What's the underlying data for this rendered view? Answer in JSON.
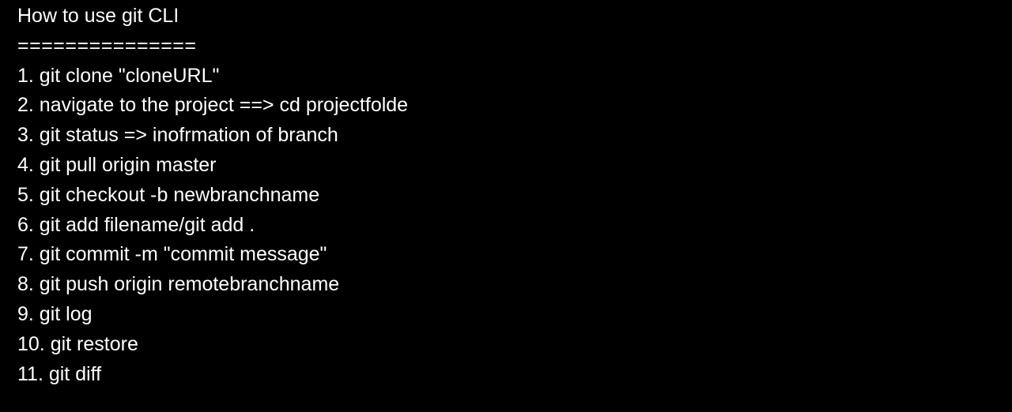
{
  "document": {
    "title": "How to use git CLI",
    "divider": "===============",
    "steps": [
      "1. git clone \"cloneURL\"",
      "2. navigate to the project ==> cd projectfolde",
      "3. git status => inofrmation of branch",
      "4. git pull origin master",
      "5. git checkout -b newbranchname",
      "6. git add filename/git add .",
      "7. git commit -m \"commit message\"",
      "8. git push origin remotebranchname",
      "9. git log",
      "10. git restore",
      "11. git diff"
    ]
  },
  "colors": {
    "background": "#000000",
    "text": "#ffffff"
  }
}
